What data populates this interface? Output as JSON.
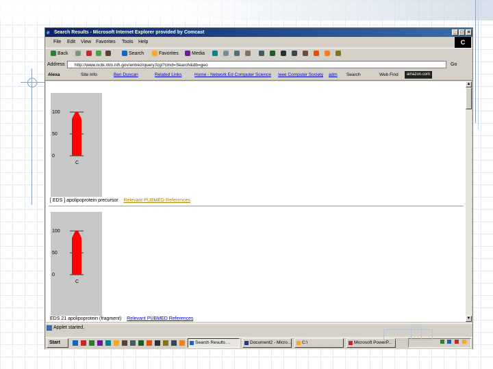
{
  "window": {
    "title": "Search Results - Microsoft Internet Explorer provided by Comcast",
    "controls": [
      "_",
      "□",
      "×"
    ]
  },
  "menu": [
    "File",
    "Edit",
    "View",
    "Favorites",
    "Tools",
    "Help"
  ],
  "brand_logo": "C",
  "toolbar": {
    "back": "Back",
    "search": "Search",
    "favorites": "Favorites",
    "media": "Media"
  },
  "address": {
    "label": "Address",
    "value": "http://www.ncbi.nlm.nih.gov/entrez/query.fcgi?cmd=Search&db=geo",
    "go": "Go"
  },
  "links": {
    "items": [
      "Alexa",
      "Site Info",
      "Ben Duncan",
      "Related Links",
      "Home - Network Ed Computer Science",
      "Ieee Computer Society",
      "adm",
      "Search",
      "Web Find"
    ],
    "amazon": "amazon.com"
  },
  "results": [
    {
      "chart_data": {
        "type": "bar",
        "categories": [
          "C"
        ],
        "values": [
          100
        ],
        "yticks": [
          "100",
          "50",
          "0"
        ],
        "ylim": [
          0,
          100
        ],
        "bar_color": "#ff0000"
      },
      "id_text": "[ EDS ]",
      "description": "apolipoprotein precursor",
      "link": "Relevant PUBMED References"
    },
    {
      "chart_data": {
        "type": "bar",
        "categories": [
          "C"
        ],
        "values": [
          100
        ],
        "yticks": [
          "100",
          "50",
          "0"
        ],
        "ylim": [
          0,
          100
        ],
        "bar_color": "#ff0000"
      },
      "id_text": "EDS 21",
      "description": "apolipoprotein (fragment)",
      "link": "Relevant PUBMED References"
    }
  ],
  "status": {
    "text": "Applet started."
  },
  "taskbar": {
    "start": "Start",
    "tasks": [
      "Search Results ...",
      "Document2 - Micro...",
      "C:\\",
      "Microsoft PowerP..."
    ],
    "active_index": 0
  },
  "colors": {
    "title_gradient_start": "#0a246a",
    "title_gradient_end": "#3a6ea5",
    "chart_bar": "#ff0000",
    "chart_panel": "#c8c8c8",
    "link_gold": "#b08000"
  }
}
